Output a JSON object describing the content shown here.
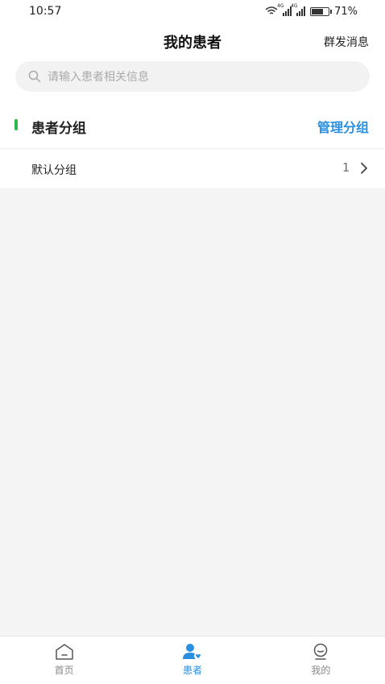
{
  "status_bar": {
    "time": "10:57",
    "network_1": "4G",
    "network_2": "4G",
    "battery_percent": "71%",
    "battery_level": 0.71
  },
  "header": {
    "title": "我的患者",
    "action": "群发消息"
  },
  "search": {
    "placeholder": "请输入患者相关信息"
  },
  "section": {
    "title": "患者分组",
    "action": "管理分组"
  },
  "groups": [
    {
      "name": "默认分组",
      "count": "1"
    }
  ],
  "tabs": [
    {
      "label": "首页",
      "icon": "home-icon",
      "active": false
    },
    {
      "label": "患者",
      "icon": "patient-icon",
      "active": true
    },
    {
      "label": "我的",
      "icon": "profile-icon",
      "active": false
    }
  ],
  "colors": {
    "accent": "#2a8fe0",
    "section_marker": "#2db84d",
    "background": "#f4f4f4"
  }
}
